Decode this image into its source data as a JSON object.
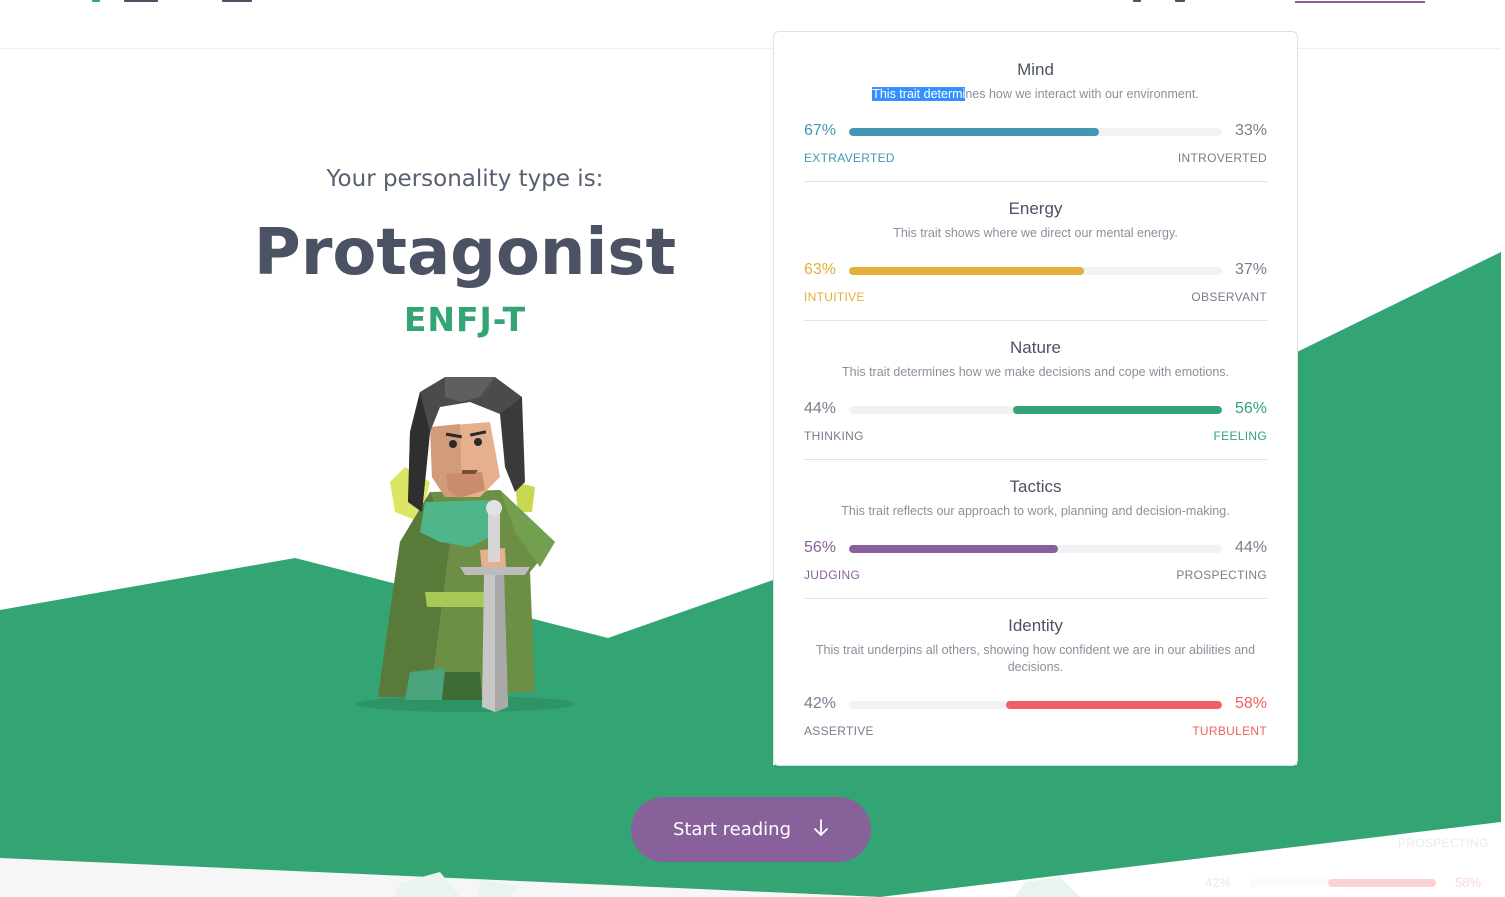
{
  "hero": {
    "label": "Your personality type is:",
    "type_name": "Protagonist",
    "type_code": "ENFJ-T"
  },
  "traits": [
    {
      "title": "Mind",
      "desc_selected": "This trait determi",
      "desc_rest": "nes how we interact with our environment.",
      "left_pct": "67%",
      "right_pct": "33%",
      "left_pole": "EXTRAVERTED",
      "right_pole": "INTROVERTED",
      "value_percent": 67,
      "dominant": "left",
      "color": "#4298b4"
    },
    {
      "title": "Energy",
      "desc": "This trait shows where we direct our mental energy.",
      "left_pct": "63%",
      "right_pct": "37%",
      "left_pole": "INTUITIVE",
      "right_pole": "OBSERVANT",
      "value_percent": 63,
      "dominant": "left",
      "color": "#e4ae3a"
    },
    {
      "title": "Nature",
      "desc": "This trait determines how we make decisions and cope with emotions.",
      "left_pct": "44%",
      "right_pct": "56%",
      "left_pole": "THINKING",
      "right_pole": "FEELING",
      "value_percent": 56,
      "dominant": "right",
      "color": "#33a474"
    },
    {
      "title": "Tactics",
      "desc": "This trait reflects our approach to work, planning and decision-making.",
      "left_pct": "56%",
      "right_pct": "44%",
      "left_pole": "JUDGING",
      "right_pole": "PROSPECTING",
      "value_percent": 56,
      "dominant": "left",
      "color": "#88619a"
    },
    {
      "title": "Identity",
      "desc": "This trait underpins all others, showing how confident we are in our abilities and decisions.",
      "left_pct": "42%",
      "right_pct": "58%",
      "left_pole": "ASSERTIVE",
      "right_pole": "TURBULENT",
      "value_percent": 58,
      "dominant": "right",
      "color": "#f25e62"
    }
  ],
  "start_button": {
    "label": "Start reading",
    "icon": "arrow-down-icon"
  },
  "ghost": {
    "prospecting": "PROSPECTING",
    "left_pct": "42%",
    "right_pct": "58%"
  },
  "colors": {
    "green": "#33a474",
    "purple": "#88619a",
    "text": "#4b5264"
  }
}
